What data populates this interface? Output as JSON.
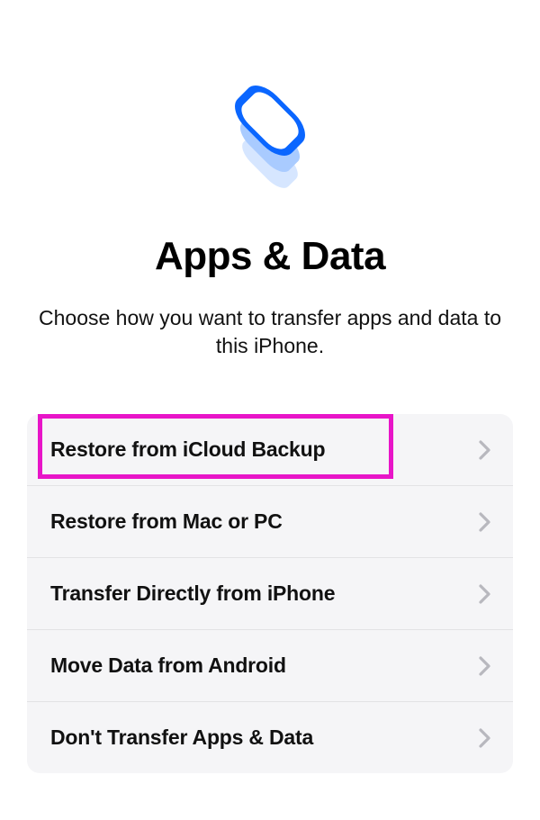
{
  "header": {
    "title": "Apps & Data",
    "subtitle": "Choose how you want to transfer apps and data to this iPhone."
  },
  "options": [
    {
      "id": "restore-icloud",
      "label": "Restore from iCloud Backup"
    },
    {
      "id": "restore-mac-pc",
      "label": "Restore from Mac or PC"
    },
    {
      "id": "transfer-iphone",
      "label": "Transfer Directly from iPhone"
    },
    {
      "id": "move-android",
      "label": "Move Data from Android"
    },
    {
      "id": "dont-transfer",
      "label": "Don't Transfer Apps & Data"
    }
  ],
  "colors": {
    "accent_blue": "#0a66ff",
    "highlight": "#e815c8"
  }
}
